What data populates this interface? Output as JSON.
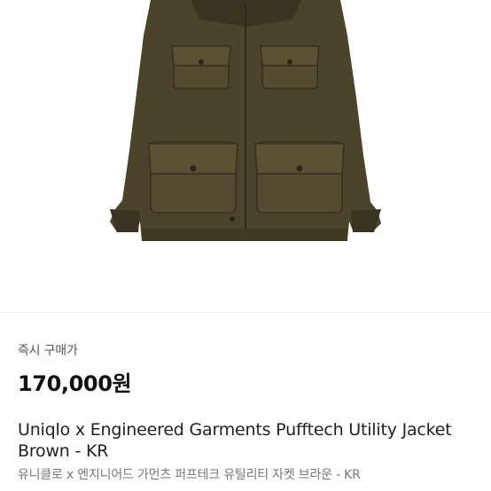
{
  "product": {
    "image_alt": "jacket-product-photo",
    "price_label": "즉시 구매가",
    "price": "170,000원",
    "title": "Uniqlo x Engineered Garments Pufftech Utility Jacket Brown - KR",
    "subtitle": "유니클로 x 엔지니어드 가먼츠 퍼프테크 유틸리티 자켓 브라운 - KR"
  },
  "colors": {
    "jacket": "#4b432a",
    "jacket_dark": "#3a3320",
    "jacket_light": "#5b5234",
    "background": "#ffffff"
  }
}
